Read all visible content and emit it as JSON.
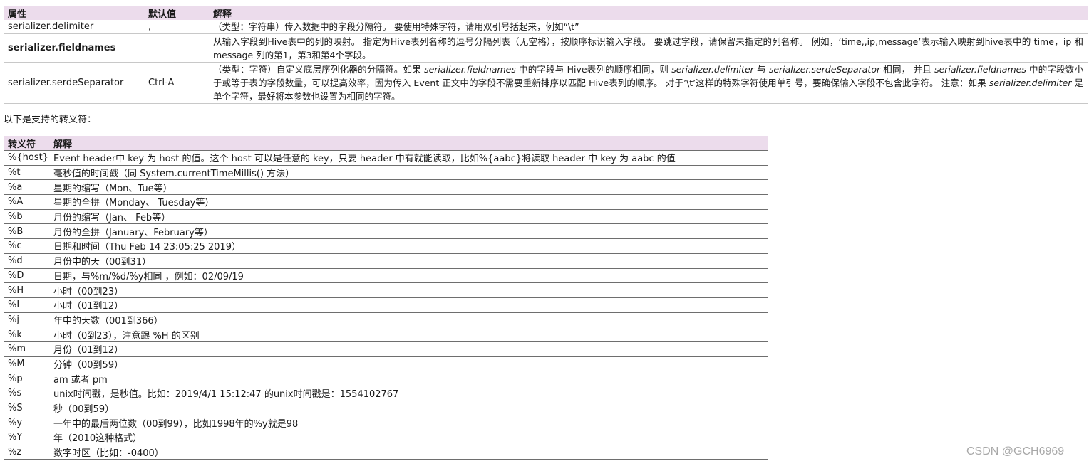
{
  "props_table": {
    "headers": [
      "属性",
      "默认值",
      "解释"
    ],
    "rows": [
      {
        "name": "serializer.delimiter",
        "default": ",",
        "desc": "（类型：字符串）传入数据中的字段分隔符。 要使用特殊字符，请用双引号括起来，例如“\\t”"
      },
      {
        "name": "serializer.fieldnames",
        "default": "–",
        "desc": "从输入字段到Hive表中的列的映射。 指定为Hive表列名称的逗号分隔列表（无空格），按顺序标识输入字段。 要跳过字段，请保留未指定的列名称。 例如，‘time,,ip,message’表示输入映射到hive表中的 time，ip 和 message 列的第1，第3和第4个字段。"
      },
      {
        "name": "serializer.serdeSeparator",
        "default": "Ctrl-A",
        "desc_1": "（类型：字符）自定义底层序列化器的分隔符。如果 ",
        "desc_2": "serializer.fieldnames",
        "desc_3": " 中的字段与 Hive表列的顺序相同，则 ",
        "desc_4": "serializer.delimiter",
        "desc_5": " 与 ",
        "desc_6": "serializer.serdeSeparator",
        "desc_7": " 相同， 并且 ",
        "desc_8": "serializer.fieldnames",
        "desc_9": " 中的字段数小于或等于表的字段数量，可以提高效率，因为传入 Event 正文中的字段不需要重新排序以匹配 Hive表列的顺序。 对于’\\t’这样的特殊字符使用单引号，要确保输入字段不包含此字符。 注意：如果 ",
        "desc_10": "serializer.delimiter",
        "desc_11": " 是单个字符，最好将本参数也设置为相同的字符。"
      }
    ]
  },
  "intro_text": "以下是支持的转义符：",
  "escapes_table": {
    "headers": [
      "转义符",
      "解释"
    ],
    "rows": [
      [
        "%{host}",
        "Event header中 key 为 host 的值。这个 host 可以是任意的 key，只要 header 中有就能读取，比如%{aabc}将读取 header 中 key 为 aabc 的值"
      ],
      [
        "%t",
        "毫秒值的时间戳（同 System.currentTimeMillis() 方法）"
      ],
      [
        "%a",
        "星期的缩写（Mon、Tue等）"
      ],
      [
        "%A",
        "星期的全拼（Monday、 Tuesday等）"
      ],
      [
        "%b",
        "月份的缩写（Jan、 Feb等）"
      ],
      [
        "%B",
        "月份的全拼（January、February等）"
      ],
      [
        "%c",
        "日期和时间（Thu Feb 14 23:05:25 2019）"
      ],
      [
        "%d",
        "月份中的天（00到31）"
      ],
      [
        "%D",
        "日期，与%m/%d/%y相同 ，例如：02/09/19"
      ],
      [
        "%H",
        "小时（00到23）"
      ],
      [
        "%I",
        "小时（01到12）"
      ],
      [
        "%j",
        "年中的天数（001到366）"
      ],
      [
        "%k",
        "小时（0到23），注意跟 %H 的区别"
      ],
      [
        "%m",
        "月份（01到12）"
      ],
      [
        "%M",
        "分钟（00到59）"
      ],
      [
        "%p",
        "am 或者 pm"
      ],
      [
        "%s",
        "unix时间戳，是秒值。比如：2019/4/1 15:12:47 的unix时间戳是：1554102767"
      ],
      [
        "%S",
        "秒（00到59）"
      ],
      [
        "%y",
        "一年中的最后两位数（00到99），比如1998年的%y就是98"
      ],
      [
        "%Y",
        "年（2010这种格式）"
      ],
      [
        "%z",
        "数字时区（比如：-0400）"
      ]
    ]
  },
  "watermark": "CSDN @GCH6969"
}
